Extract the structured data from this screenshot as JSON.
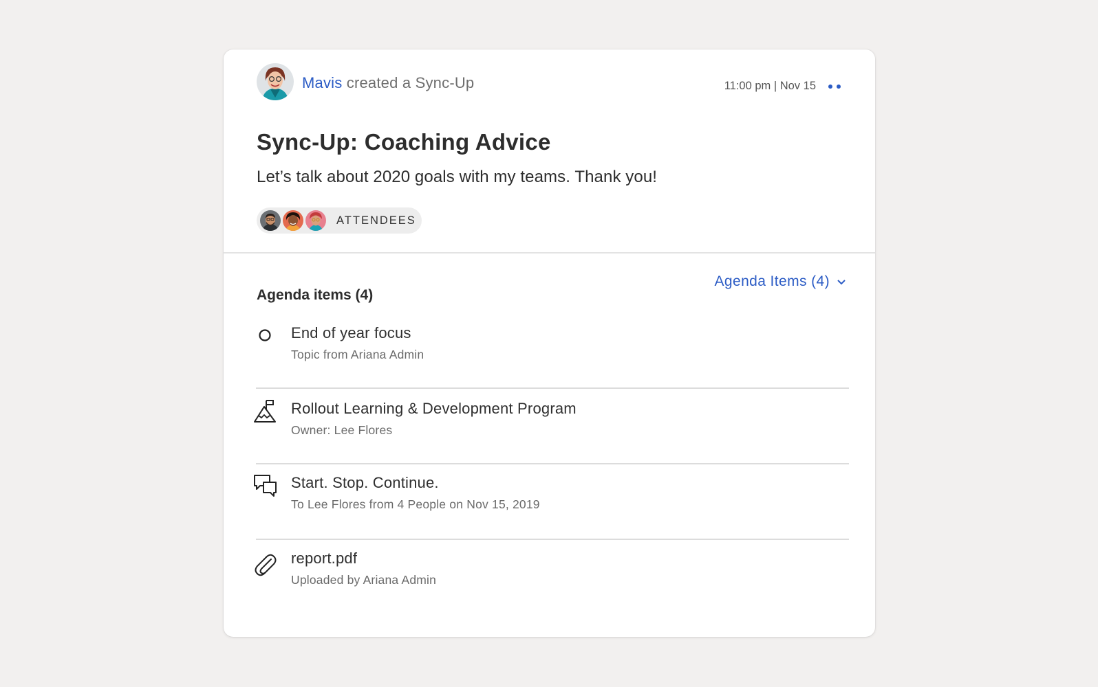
{
  "post": {
    "author": "Mavis",
    "action_text": "created a Sync-Up",
    "time": "11:00 pm | Nov 15"
  },
  "syncup": {
    "title": "Sync-Up: Coaching Advice",
    "description": "Let’s talk about 2020 goals with my teams. Thank you!",
    "attendees_label": "ATTENDEES"
  },
  "agenda": {
    "heading": "Agenda items (4)",
    "dropdown_label": "Agenda Items (4)",
    "items": [
      {
        "icon": "circle-icon",
        "title": "End of year focus",
        "subtitle": "Topic from Ariana Admin"
      },
      {
        "icon": "mountain-flag-icon",
        "title": "Rollout Learning & Development Program",
        "subtitle": "Owner: Lee Flores"
      },
      {
        "icon": "chat-bubbles-icon",
        "title": "Start. Stop. Continue.",
        "subtitle": "To Lee Flores from 4 People on Nov 15, 2019"
      },
      {
        "icon": "paperclip-icon",
        "title": "report.pdf",
        "subtitle": "Uploaded by Ariana Admin"
      }
    ]
  },
  "colors": {
    "accent": "#2c5cc5",
    "background": "#f2f0ef",
    "card": "#ffffff"
  }
}
